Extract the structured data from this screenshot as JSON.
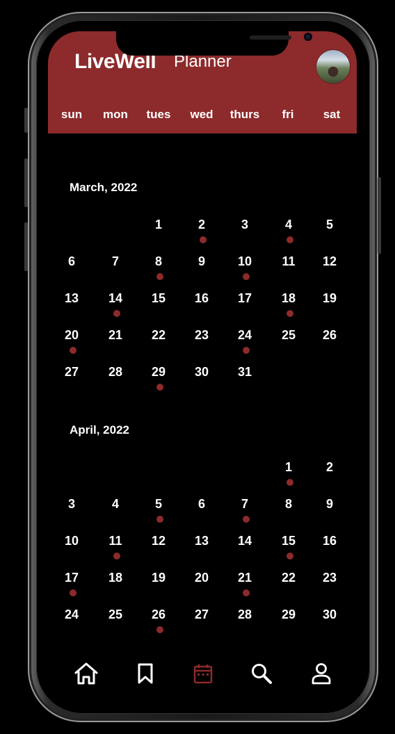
{
  "app": {
    "logo": "LiveWell",
    "title": "Planner"
  },
  "weekdays": [
    "sun",
    "mon",
    "tues",
    "wed",
    "thurs",
    "fri",
    "sat"
  ],
  "months": [
    {
      "title": "March, 2022",
      "first_weekday": 2,
      "days": 31,
      "marked": [
        2,
        4,
        8,
        10,
        14,
        18,
        20,
        24,
        29
      ]
    },
    {
      "title": "April, 2022",
      "first_weekday": 5,
      "days": 30,
      "marked": [
        1,
        5,
        7,
        11,
        15,
        17,
        21,
        26
      ]
    }
  ],
  "nav": [
    {
      "name": "home",
      "active": false
    },
    {
      "name": "bookmark",
      "active": false
    },
    {
      "name": "calendar",
      "active": true
    },
    {
      "name": "search",
      "active": false
    },
    {
      "name": "profile",
      "active": false
    }
  ],
  "colors": {
    "accent": "#8d2a2b",
    "background": "#000000",
    "text": "#ffffff",
    "icon_inactive": "#ffffff"
  }
}
